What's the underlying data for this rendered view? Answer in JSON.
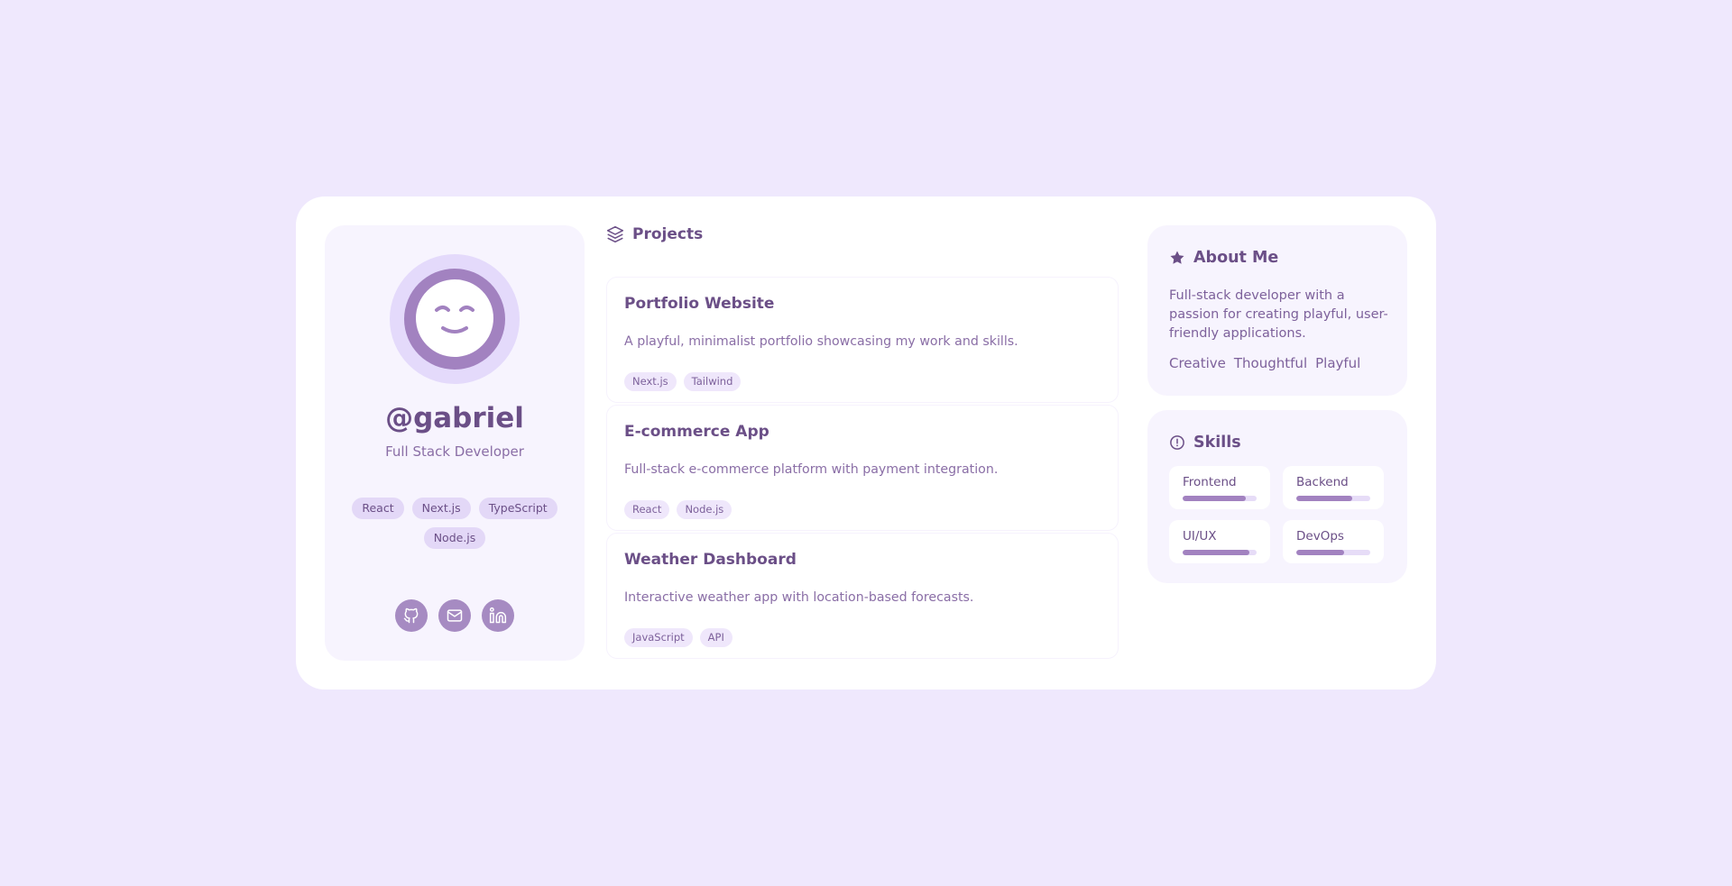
{
  "profile": {
    "username": "@gabriel",
    "role": "Full Stack Developer",
    "tech": [
      "React",
      "Next.js",
      "TypeScript",
      "Node.js"
    ],
    "socials": [
      "github-icon",
      "mail-icon",
      "linkedin-icon"
    ]
  },
  "projects": {
    "heading": "Projects",
    "items": [
      {
        "title": "Portfolio Website",
        "description": "A playful, minimalist portfolio showcasing my work and skills.",
        "tags": [
          "Next.js",
          "Tailwind"
        ]
      },
      {
        "title": "E-commerce App",
        "description": "Full-stack e-commerce platform with payment integration.",
        "tags": [
          "React",
          "Node.js"
        ]
      },
      {
        "title": "Weather Dashboard",
        "description": "Interactive weather app with location-based forecasts.",
        "tags": [
          "JavaScript",
          "API"
        ]
      }
    ]
  },
  "about": {
    "heading": "About Me",
    "text": "Full-stack developer with a passion for creating playful, user-friendly applications.",
    "traits": [
      "Creative",
      "Thoughtful",
      "Playful"
    ]
  },
  "skills": {
    "heading": "Skills",
    "items": [
      {
        "name": "Frontend",
        "level": 0.85
      },
      {
        "name": "Backend",
        "level": 0.75
      },
      {
        "name": "UI/UX",
        "level": 0.9
      },
      {
        "name": "DevOps",
        "level": 0.65
      }
    ]
  },
  "colors": {
    "background": "#efe8fd",
    "accent": "#a282c0",
    "text": "#6b4f87"
  }
}
